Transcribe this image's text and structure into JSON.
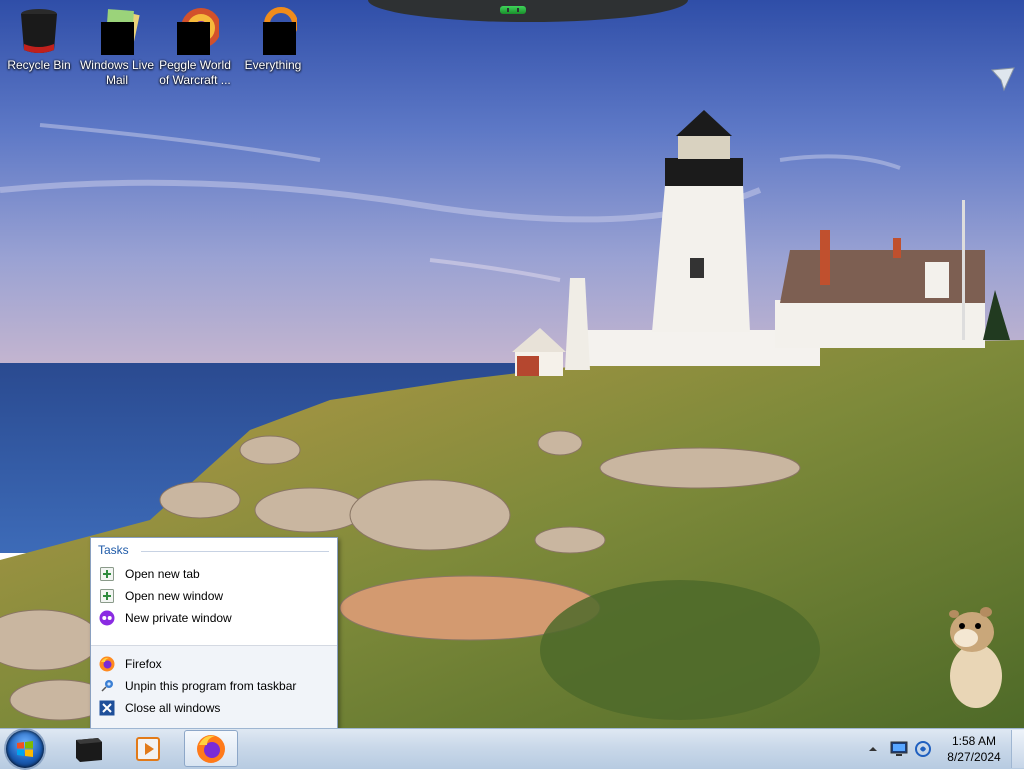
{
  "desktop": {
    "icons": [
      {
        "name": "recycle-bin",
        "label": "Recycle Bin"
      },
      {
        "name": "windows-live-mail",
        "label": "Windows Live Mail"
      },
      {
        "name": "peggle-world-of-warcraft",
        "label": "Peggle World of Warcraft ..."
      },
      {
        "name": "everything",
        "label": "Everything"
      }
    ]
  },
  "jump_list": {
    "header": "Tasks",
    "tasks": [
      {
        "label": "Open new tab",
        "icon": "new-tab-icon"
      },
      {
        "label": "Open new window",
        "icon": "new-window-icon"
      },
      {
        "label": "New private window",
        "icon": "private-mask-icon"
      }
    ],
    "actions": [
      {
        "label": "Firefox",
        "icon": "firefox-icon"
      },
      {
        "label": "Unpin this program from taskbar",
        "icon": "unpin-icon"
      },
      {
        "label": "Close all windows",
        "icon": "close-window-icon"
      }
    ]
  },
  "taskbar": {
    "clock_time": "1:58 AM",
    "clock_date": "8/27/2024"
  },
  "colors": {
    "menu_header": "#1e5aa8",
    "taskbar": "#c9d8e9"
  }
}
